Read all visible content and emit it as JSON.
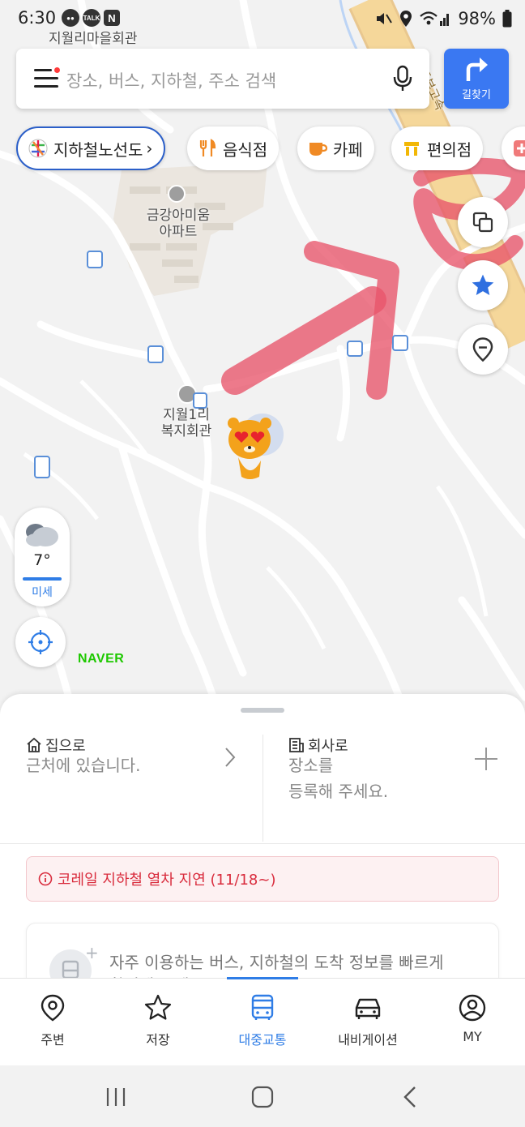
{
  "status_bar": {
    "time": "6:30",
    "notif_icons": [
      "chat-bubble-icon",
      "kakaotalk-icon",
      "naver-n-icon"
    ],
    "talk_badge": "TALK",
    "naver_badge": "N",
    "battery": "98%"
  },
  "map": {
    "labels": {
      "village_hall": "지월리마을회관",
      "apartment_line1": "금강아미움",
      "apartment_line2": "아파트",
      "welfare_line1": "지월1리",
      "welfare_line2": "복지회관",
      "highway": "중부고속"
    },
    "naver": "NAVER",
    "weather": {
      "temp": "7°",
      "dust": "미세"
    },
    "colors": {
      "highway": "#f5d79a",
      "annotation": "#e8556a"
    }
  },
  "search": {
    "placeholder": "장소, 버스, 지하철, 주소 검색"
  },
  "route_button": {
    "label": "길찾기"
  },
  "chips": [
    {
      "label": "지하철노선도",
      "icon": "subway-map-icon"
    },
    {
      "label": "음식점",
      "icon": "restaurant-icon"
    },
    {
      "label": "카페",
      "icon": "cafe-icon"
    },
    {
      "label": "편의점",
      "icon": "convenience-store-icon"
    }
  ],
  "sheet": {
    "home": {
      "title": "집으로",
      "sub": "근처에 있습니다."
    },
    "work": {
      "title": "회사로",
      "sub_line1": "장소를",
      "sub_line2": "등록해 주세요."
    },
    "alert": "코레일 지하철 열차 지연 (11/18~)",
    "transit_line1": "자주 이용하는 버스, 지하철의 도착 정보를 빠르게",
    "transit_line2": "확인해 보세요."
  },
  "nav": [
    {
      "label": "주변",
      "icon": "nearby-pin-icon"
    },
    {
      "label": "저장",
      "icon": "star-icon"
    },
    {
      "label": "대중교통",
      "icon": "bus-icon",
      "active": true
    },
    {
      "label": "내비게이션",
      "icon": "car-icon"
    },
    {
      "label": "MY",
      "icon": "profile-icon"
    }
  ]
}
